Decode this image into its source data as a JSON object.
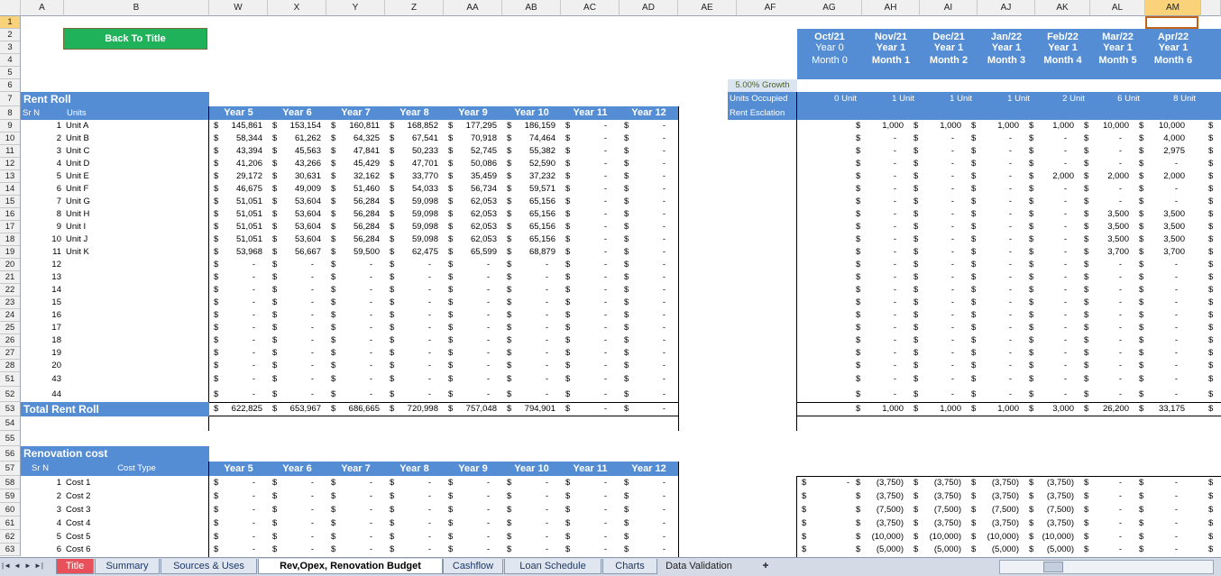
{
  "columns": {
    "left": [
      "A",
      "B",
      "W",
      "X",
      "Y",
      "Z",
      "AA",
      "AB",
      "AC",
      "AD",
      "AE",
      "AF"
    ],
    "right": [
      "AG",
      "AH",
      "AI",
      "AJ",
      "AK",
      "AL",
      "AM"
    ],
    "selected": "AM"
  },
  "rows": [
    "1",
    "2",
    "3",
    "4",
    "5",
    "6",
    "7",
    "8",
    "9",
    "10",
    "11",
    "12",
    "13",
    "14",
    "15",
    "16",
    "17",
    "18",
    "19",
    "20",
    "21",
    "22",
    "23",
    "24",
    "25",
    "26",
    "27",
    "28",
    "51",
    "52",
    "53",
    "54",
    "55",
    "56",
    "57",
    "58",
    "59",
    "60",
    "61",
    "62",
    "63"
  ],
  "selected_row": "1",
  "back_button": "Back To Title",
  "growth_label": "5.00% Growth",
  "rent_roll": {
    "title": "Rent Roll",
    "sr_label": "Sr N",
    "units_label": "Units",
    "years": [
      "Year 5",
      "Year 6",
      "Year 7",
      "Year 8",
      "Year 9",
      "Year 10",
      "Year 11",
      "Year 12"
    ],
    "rows": [
      {
        "n": "1",
        "unit": "Unit A",
        "v": [
          "145,861",
          "153,154",
          "160,811",
          "168,852",
          "177,295",
          "186,159",
          "-",
          "-"
        ]
      },
      {
        "n": "2",
        "unit": "Unit B",
        "v": [
          "58,344",
          "61,262",
          "64,325",
          "67,541",
          "70,918",
          "74,464",
          "-",
          "-"
        ]
      },
      {
        "n": "3",
        "unit": "Unit C",
        "v": [
          "43,394",
          "45,563",
          "47,841",
          "50,233",
          "52,745",
          "55,382",
          "-",
          "-"
        ]
      },
      {
        "n": "4",
        "unit": "Unit D",
        "v": [
          "41,206",
          "43,266",
          "45,429",
          "47,701",
          "50,086",
          "52,590",
          "-",
          "-"
        ]
      },
      {
        "n": "5",
        "unit": "Unit E",
        "v": [
          "29,172",
          "30,631",
          "32,162",
          "33,770",
          "35,459",
          "37,232",
          "-",
          "-"
        ]
      },
      {
        "n": "6",
        "unit": "Unit F",
        "v": [
          "46,675",
          "49,009",
          "51,460",
          "54,033",
          "56,734",
          "59,571",
          "-",
          "-"
        ]
      },
      {
        "n": "7",
        "unit": "Unit G",
        "v": [
          "51,051",
          "53,604",
          "56,284",
          "59,098",
          "62,053",
          "65,156",
          "-",
          "-"
        ]
      },
      {
        "n": "8",
        "unit": "Unit H",
        "v": [
          "51,051",
          "53,604",
          "56,284",
          "59,098",
          "62,053",
          "65,156",
          "-",
          "-"
        ]
      },
      {
        "n": "9",
        "unit": "Unit I",
        "v": [
          "51,051",
          "53,604",
          "56,284",
          "59,098",
          "62,053",
          "65,156",
          "-",
          "-"
        ]
      },
      {
        "n": "10",
        "unit": "Unit J",
        "v": [
          "51,051",
          "53,604",
          "56,284",
          "59,098",
          "62,053",
          "65,156",
          "-",
          "-"
        ]
      },
      {
        "n": "11",
        "unit": "Unit K",
        "v": [
          "53,968",
          "56,667",
          "59,500",
          "62,475",
          "65,599",
          "68,879",
          "-",
          "-"
        ]
      },
      {
        "n": "12",
        "unit": "",
        "v": [
          "-",
          "-",
          "-",
          "-",
          "-",
          "-",
          "-",
          "-"
        ]
      },
      {
        "n": "13",
        "unit": "",
        "v": [
          "-",
          "-",
          "-",
          "-",
          "-",
          "-",
          "-",
          "-"
        ]
      },
      {
        "n": "14",
        "unit": "",
        "v": [
          "-",
          "-",
          "-",
          "-",
          "-",
          "-",
          "-",
          "-"
        ]
      },
      {
        "n": "15",
        "unit": "",
        "v": [
          "-",
          "-",
          "-",
          "-",
          "-",
          "-",
          "-",
          "-"
        ]
      },
      {
        "n": "16",
        "unit": "",
        "v": [
          "-",
          "-",
          "-",
          "-",
          "-",
          "-",
          "-",
          "-"
        ]
      },
      {
        "n": "17",
        "unit": "",
        "v": [
          "-",
          "-",
          "-",
          "-",
          "-",
          "-",
          "-",
          "-"
        ]
      },
      {
        "n": "18",
        "unit": "",
        "v": [
          "-",
          "-",
          "-",
          "-",
          "-",
          "-",
          "-",
          "-"
        ]
      },
      {
        "n": "19",
        "unit": "",
        "v": [
          "-",
          "-",
          "-",
          "-",
          "-",
          "-",
          "-",
          "-"
        ]
      },
      {
        "n": "20",
        "unit": "",
        "v": [
          "-",
          "-",
          "-",
          "-",
          "-",
          "-",
          "-",
          "-"
        ]
      },
      {
        "n": "43",
        "unit": "",
        "v": [
          "-",
          "-",
          "-",
          "-",
          "-",
          "-",
          "-",
          "-"
        ]
      },
      {
        "n": "44",
        "unit": "",
        "v": [
          "-",
          "-",
          "-",
          "-",
          "-",
          "-",
          "-",
          "-"
        ]
      }
    ],
    "total_label": "Total Rent Roll",
    "total": [
      "622,825",
      "653,967",
      "686,665",
      "720,998",
      "757,048",
      "794,901",
      "-",
      "-"
    ]
  },
  "monthly": {
    "dates": [
      "Oct/21",
      "Nov/21",
      "Dec/21",
      "Jan/22",
      "Feb/22",
      "Mar/22",
      "Apr/22"
    ],
    "years": [
      "Year 0",
      "Year 1",
      "Year 1",
      "Year 1",
      "Year 1",
      "Year 1",
      "Year 1"
    ],
    "months": [
      "Month 0",
      "Month 1",
      "Month 2",
      "Month 3",
      "Month 4",
      "Month 5",
      "Month 6"
    ],
    "units_occupied_label": "Units Occupied",
    "rent_escalation_label": "Rent Esclation",
    "units_occupied": [
      "0 Unit",
      "1 Unit",
      "1 Unit",
      "1 Unit",
      "2 Unit",
      "6 Unit",
      "8 Unit"
    ],
    "rows": [
      [
        "",
        "1,000",
        "1,000",
        "1,000",
        "1,000",
        "10,000",
        "10,000"
      ],
      [
        "",
        "-",
        "-",
        "-",
        "-",
        "-",
        "4,000"
      ],
      [
        "",
        "-",
        "-",
        "-",
        "-",
        "-",
        "2,975"
      ],
      [
        "",
        "-",
        "-",
        "-",
        "-",
        "-",
        "-"
      ],
      [
        "",
        "-",
        "-",
        "-",
        "2,000",
        "2,000",
        "2,000"
      ],
      [
        "",
        "-",
        "-",
        "-",
        "-",
        "-",
        "-"
      ],
      [
        "",
        "-",
        "-",
        "-",
        "-",
        "-",
        "-"
      ],
      [
        "",
        "-",
        "-",
        "-",
        "-",
        "3,500",
        "3,500"
      ],
      [
        "",
        "-",
        "-",
        "-",
        "-",
        "3,500",
        "3,500"
      ],
      [
        "",
        "-",
        "-",
        "-",
        "-",
        "3,500",
        "3,500"
      ],
      [
        "",
        "-",
        "-",
        "-",
        "-",
        "3,700",
        "3,700"
      ],
      [
        "",
        "-",
        "-",
        "-",
        "-",
        "-",
        "-"
      ],
      [
        "",
        "-",
        "-",
        "-",
        "-",
        "-",
        "-"
      ],
      [
        "",
        "-",
        "-",
        "-",
        "-",
        "-",
        "-"
      ],
      [
        "",
        "-",
        "-",
        "-",
        "-",
        "-",
        "-"
      ],
      [
        "",
        "-",
        "-",
        "-",
        "-",
        "-",
        "-"
      ],
      [
        "",
        "-",
        "-",
        "-",
        "-",
        "-",
        "-"
      ],
      [
        "",
        "-",
        "-",
        "-",
        "-",
        "-",
        "-"
      ],
      [
        "",
        "-",
        "-",
        "-",
        "-",
        "-",
        "-"
      ],
      [
        "",
        "-",
        "-",
        "-",
        "-",
        "-",
        "-"
      ],
      [
        "",
        "-",
        "-",
        "-",
        "-",
        "-",
        "-"
      ],
      [
        "",
        "-",
        "-",
        "-",
        "-",
        "-",
        "-"
      ]
    ],
    "total": [
      "",
      "1,000",
      "1,000",
      "1,000",
      "3,000",
      "26,200",
      "33,175"
    ],
    "renovation": [
      [
        "-",
        "(3,750)",
        "(3,750)",
        "(3,750)",
        "(3,750)",
        "-",
        "-"
      ],
      [
        "",
        "(3,750)",
        "(3,750)",
        "(3,750)",
        "(3,750)",
        "-",
        "-"
      ],
      [
        "",
        "(7,500)",
        "(7,500)",
        "(7,500)",
        "(7,500)",
        "-",
        "-"
      ],
      [
        "",
        "(3,750)",
        "(3,750)",
        "(3,750)",
        "(3,750)",
        "-",
        "-"
      ],
      [
        "",
        "(10,000)",
        "(10,000)",
        "(10,000)",
        "(10,000)",
        "-",
        "-"
      ],
      [
        "",
        "(5,000)",
        "(5,000)",
        "(5,000)",
        "(5,000)",
        "-",
        "-"
      ]
    ]
  },
  "renovation": {
    "title": "Renovation cost",
    "sr_label": "Sr N",
    "type_label": "Cost Type",
    "years": [
      "Year 5",
      "Year 6",
      "Year 7",
      "Year 8",
      "Year 9",
      "Year 10",
      "Year 11",
      "Year 12"
    ],
    "rows": [
      {
        "n": "1",
        "name": "Cost 1"
      },
      {
        "n": "2",
        "name": "Cost 2"
      },
      {
        "n": "3",
        "name": "Cost 3"
      },
      {
        "n": "4",
        "name": "Cost 4"
      },
      {
        "n": "5",
        "name": "Cost 5"
      },
      {
        "n": "6",
        "name": "Cost 6"
      }
    ],
    "value": "-"
  },
  "currency_symbol": "$",
  "tabs": [
    {
      "label": "Title",
      "style": "red"
    },
    {
      "label": "Summary",
      "style": ""
    },
    {
      "label": "Sources & Uses",
      "style": ""
    },
    {
      "label": "Rev,Opex, Renovation Budget",
      "style": "active"
    },
    {
      "label": "Cashflow",
      "style": ""
    },
    {
      "label": "Loan Schedule",
      "style": ""
    },
    {
      "label": "Charts",
      "style": ""
    },
    {
      "label": "Data Validation",
      "style": "plain"
    }
  ]
}
